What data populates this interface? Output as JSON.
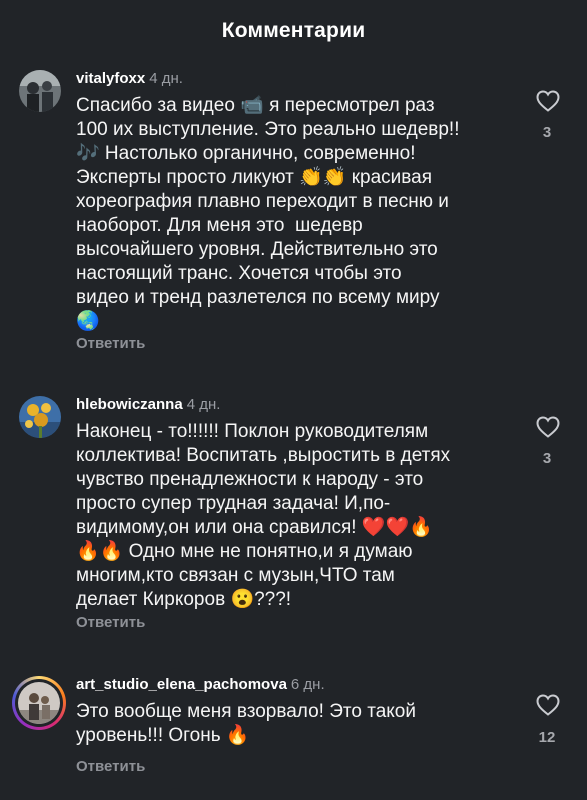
{
  "header": {
    "title": "Комментарии"
  },
  "reply_label": "Ответить",
  "comments": [
    {
      "username": "vitalyfoxx",
      "time": "4 дн.",
      "text": "Спасибо за видео 📹 я пересмотрел раз\n100 их выступление. Это реально шедевр!!\n🎶 Настолько органично, современно!\nЭксперты просто ликуют 👏👏 красивая\nхореография плавно переходит в песню и\nнаоборот. Для меня это  шедевр\nвысочайшего уровня. Действительно это\nнастоящий транс. Хочется чтобы это\nвидео и тренд разлетелся по всему миру\n🌏",
      "likes": "3"
    },
    {
      "username": "hlebowiczanna",
      "time": "4 дн.",
      "text": "Наконец - то!!!!!! Поклон руководителям\nколлектива! Воспитать ,выростить в детях\nчувство пренадлежности к народу - это\nпросто супер трудная задача! И,по-\nвидимому,он или она сравился! ❤️❤️🔥\n🔥🔥 Одно мне не понятно,и я думаю\nмногим,кто связан с музын,ЧТО там\nделает Киркоров 😮???!",
      "likes": "3"
    },
    {
      "username": "art_studio_elena_pachomova",
      "time": "6 дн.",
      "text": "Это вообще меня взорвало! Это такой\nуровень!!! Огонь 🔥",
      "likes": "12"
    }
  ],
  "icons": {
    "like": "heart-outline-icon"
  },
  "colors": {
    "background": "#212428",
    "muted": "#9a9da3"
  }
}
